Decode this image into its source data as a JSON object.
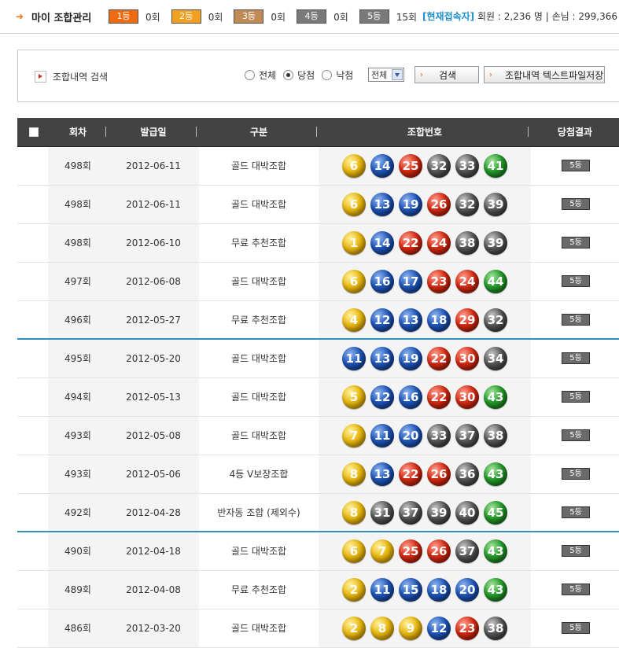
{
  "topbar": {
    "title": "마이 조합관리",
    "ranks": [
      {
        "label": "1등",
        "count": "0회",
        "color": "#f06a10"
      },
      {
        "label": "2등",
        "count": "0회",
        "color": "#f2a020"
      },
      {
        "label": "3등",
        "count": "0회",
        "color": "#c08a55"
      },
      {
        "label": "4등",
        "count": "0회",
        "color": "#7a7a7a"
      },
      {
        "label": "5등",
        "count": "15회",
        "color": "#7a7a7a"
      }
    ],
    "online_label": "[현재접속자]",
    "online_stats": "회원 : 2,236 명 | 손님 : 299,366 명"
  },
  "search": {
    "title": "조합내역 검색",
    "filters": [
      {
        "label": "전체",
        "checked": false
      },
      {
        "label": "당첨",
        "checked": true
      },
      {
        "label": "낙첨",
        "checked": false
      }
    ],
    "select_value": "전체",
    "search_button": "검색",
    "save_button": "조합내역 텍스트파일저장"
  },
  "table": {
    "headers": [
      "회차",
      "발급일",
      "구분",
      "조합번호",
      "당첨결과"
    ],
    "rows": [
      {
        "round": "498회",
        "date": "2012-06-11",
        "type": "골드 대박조합",
        "numbers": [
          6,
          14,
          25,
          32,
          33,
          41
        ],
        "result": "5등",
        "sep": false
      },
      {
        "round": "498회",
        "date": "2012-06-11",
        "type": "골드 대박조합",
        "numbers": [
          6,
          13,
          19,
          26,
          32,
          39
        ],
        "result": "5등",
        "sep": false
      },
      {
        "round": "498회",
        "date": "2012-06-10",
        "type": "무료 추천조합",
        "numbers": [
          1,
          14,
          22,
          24,
          38,
          39
        ],
        "result": "5등",
        "sep": false
      },
      {
        "round": "497회",
        "date": "2012-06-08",
        "type": "골드 대박조합",
        "numbers": [
          6,
          16,
          17,
          23,
          24,
          44
        ],
        "result": "5등",
        "sep": false
      },
      {
        "round": "496회",
        "date": "2012-05-27",
        "type": "무료 추천조합",
        "numbers": [
          4,
          12,
          13,
          18,
          29,
          32
        ],
        "result": "5등",
        "sep": true
      },
      {
        "round": "495회",
        "date": "2012-05-20",
        "type": "골드 대박조합",
        "numbers": [
          11,
          13,
          19,
          22,
          30,
          34
        ],
        "result": "5등",
        "sep": false
      },
      {
        "round": "494회",
        "date": "2012-05-13",
        "type": "골드 대박조합",
        "numbers": [
          5,
          12,
          16,
          22,
          30,
          43
        ],
        "result": "5등",
        "sep": false
      },
      {
        "round": "493회",
        "date": "2012-05-08",
        "type": "골드 대박조합",
        "numbers": [
          7,
          11,
          20,
          33,
          37,
          38
        ],
        "result": "5등",
        "sep": false
      },
      {
        "round": "493회",
        "date": "2012-05-06",
        "type": "4등 V보장조합",
        "numbers": [
          8,
          13,
          22,
          26,
          36,
          43
        ],
        "result": "5등",
        "sep": false
      },
      {
        "round": "492회",
        "date": "2012-04-28",
        "type": "반자동 조합 (제외수)",
        "numbers": [
          8,
          31,
          37,
          39,
          40,
          45
        ],
        "result": "5등",
        "sep": true
      },
      {
        "round": "490회",
        "date": "2012-04-18",
        "type": "골드 대박조합",
        "numbers": [
          6,
          7,
          25,
          26,
          37,
          43
        ],
        "result": "5등",
        "sep": false
      },
      {
        "round": "489회",
        "date": "2012-04-08",
        "type": "무료 추천조합",
        "numbers": [
          2,
          11,
          15,
          18,
          20,
          43
        ],
        "result": "5등",
        "sep": false
      },
      {
        "round": "486회",
        "date": "2012-03-20",
        "type": "골드 대박조합",
        "numbers": [
          2,
          8,
          9,
          12,
          23,
          38
        ],
        "result": "5등",
        "sep": false
      }
    ]
  }
}
